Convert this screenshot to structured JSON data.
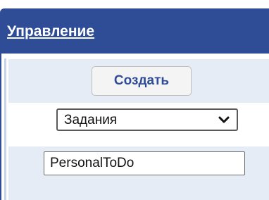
{
  "header": {
    "title": "Управление"
  },
  "actions": {
    "create_label": "Создать"
  },
  "type_select": {
    "selected": "Задания",
    "chevron_icon": "chevron-down-icon"
  },
  "name_field": {
    "value": "PersonalToDo"
  },
  "colors": {
    "header_bg": "#2f4d96",
    "row_alt_bg": "#e6ecf6",
    "accent_text": "#2f4d96"
  }
}
